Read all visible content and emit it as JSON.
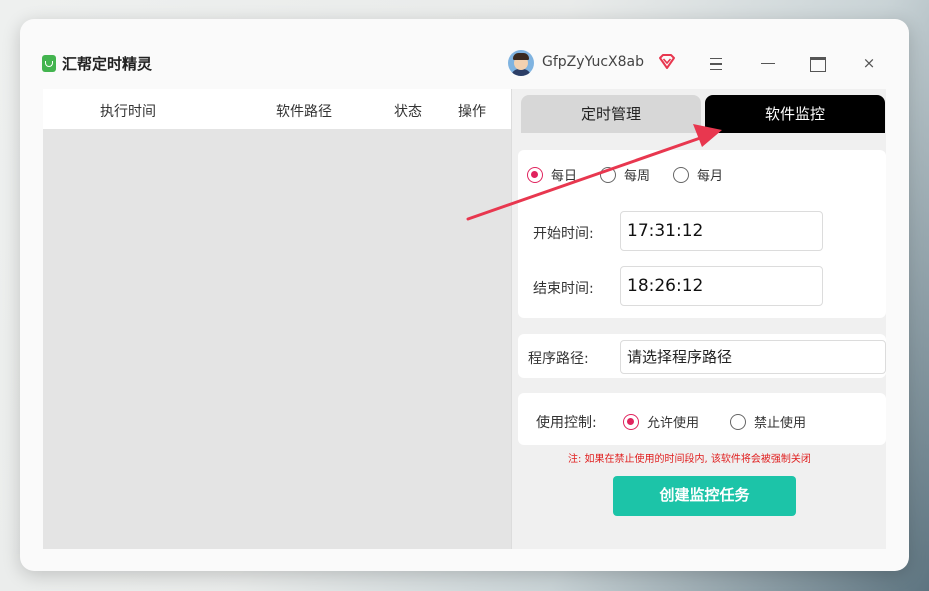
{
  "app": {
    "title": "汇帮定时精灵"
  },
  "user": {
    "name": "GfpZyYucX8ab"
  },
  "window_controls": {
    "menu": "≡",
    "minimize": "—",
    "maximize": "□",
    "close": "×"
  },
  "table": {
    "columns": [
      "执行时间",
      "软件路径",
      "状态",
      "操作"
    ]
  },
  "tabs": [
    {
      "label": "定时管理",
      "active": false
    },
    {
      "label": "软件监控",
      "active": true
    }
  ],
  "frequency": {
    "options": [
      "每日",
      "每周",
      "每月"
    ],
    "selected": "每日"
  },
  "start_time": {
    "label": "开始时间:",
    "value": "17:31:12"
  },
  "end_time": {
    "label": "结束时间:",
    "value": "18:26:12"
  },
  "program_path": {
    "label": "程序路径:",
    "placeholder": "请选择程序路径"
  },
  "usage_control": {
    "label": "使用控制:",
    "options": [
      "允许使用",
      "禁止使用"
    ],
    "selected": "允许使用"
  },
  "note": "注: 如果在禁止使用的时间段内, 该软件将会被强制关闭",
  "create_button": "创建监控任务",
  "colors": {
    "accent_radio": "#e0245e",
    "button": "#1cc4a8",
    "annotation_arrow": "#e8374f",
    "active_tab": "#000000"
  }
}
